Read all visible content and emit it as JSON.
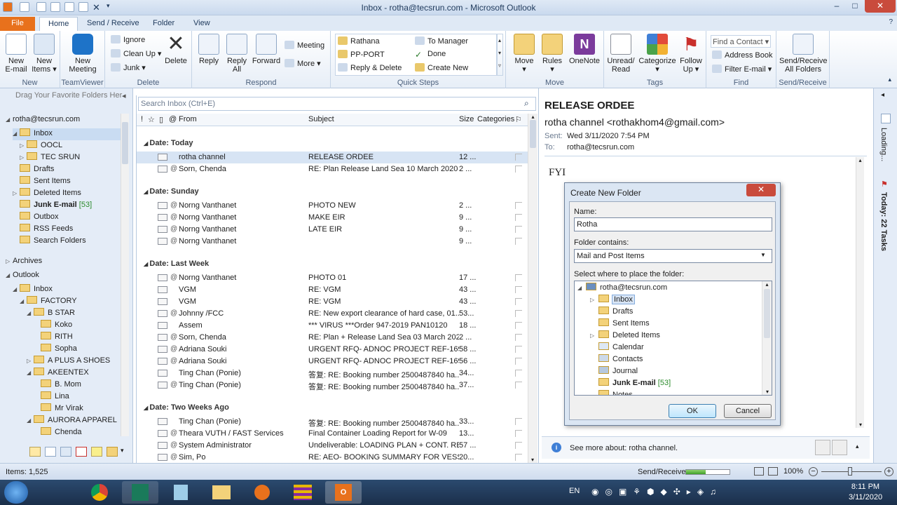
{
  "window": {
    "title": "Inbox - rotha@tecsrun.com - Microsoft Outlook",
    "minimize": "–",
    "maximize": "□",
    "close": "✕"
  },
  "tabs": [
    "File",
    "Home",
    "Send / Receive",
    "Folder",
    "View"
  ],
  "ribbon": {
    "new": {
      "new_email": "New\nE-mail",
      "new_items": "New\nItems ▾",
      "label": "New"
    },
    "teamviewer": {
      "new_meeting": "New\nMeeting",
      "label": "TeamViewer"
    },
    "delete": {
      "ignore": "Ignore",
      "clean_up": "Clean Up ▾",
      "junk": "Junk ▾",
      "delete": "Delete",
      "label": "Delete"
    },
    "respond": {
      "reply": "Reply",
      "reply_all": "Reply\nAll",
      "forward": "Forward",
      "meeting": "Meeting",
      "more": "More ▾",
      "label": "Respond"
    },
    "quick_steps": {
      "items": [
        "Rathana",
        "PP-PORT",
        "Reply & Delete",
        "To Manager",
        "Done",
        "Create New"
      ],
      "label": "Quick Steps"
    },
    "move": {
      "move": "Move\n▾",
      "rules": "Rules\n▾",
      "onenote": "OneNote",
      "label": "Move"
    },
    "tags": {
      "unread_read": "Unread/\nRead",
      "categorize": "Categorize\n▾",
      "follow_up": "Follow\nUp ▾",
      "label": "Tags"
    },
    "find": {
      "find_contact": "Find a Contact ▾",
      "address_book": "Address Book",
      "filter_email": "Filter E-mail ▾",
      "label": "Find"
    },
    "send_receive": {
      "all_folders": "Send/Receive\nAll Folders",
      "label": "Send/Receive"
    }
  },
  "nav": {
    "drag_hint": "Drag Your Favorite Folders Her",
    "account": "rotha@tecsrun.com",
    "folders": [
      {
        "name": "Inbox",
        "indent": 1,
        "arrow": "◢",
        "selected": true
      },
      {
        "name": "OOCL",
        "indent": 2,
        "arrow": "▷"
      },
      {
        "name": "TEC SRUN",
        "indent": 2,
        "arrow": "▷"
      },
      {
        "name": "Drafts",
        "indent": 1,
        "arrow": ""
      },
      {
        "name": "Sent Items",
        "indent": 1,
        "arrow": ""
      },
      {
        "name": "Deleted Items",
        "indent": 1,
        "arrow": "▷"
      },
      {
        "name": "Junk E-mail",
        "indent": 1,
        "arrow": "",
        "count": "[53]",
        "bold": true
      },
      {
        "name": "Outbox",
        "indent": 1,
        "arrow": ""
      },
      {
        "name": "RSS Feeds",
        "indent": 1,
        "arrow": ""
      },
      {
        "name": "Search Folders",
        "indent": 1,
        "arrow": ""
      }
    ],
    "archives": "Archives",
    "outlook": "Outlook",
    "outlook_folders": [
      {
        "name": "Inbox",
        "indent": 1,
        "arrow": "◢"
      },
      {
        "name": "FACTORY",
        "indent": 2,
        "arrow": "◢"
      },
      {
        "name": "B STAR",
        "indent": 3,
        "arrow": "◢"
      },
      {
        "name": "Koko",
        "indent": 4,
        "arrow": ""
      },
      {
        "name": "RITH",
        "indent": 4,
        "arrow": ""
      },
      {
        "name": "Sopha",
        "indent": 4,
        "arrow": ""
      },
      {
        "name": "A PLUS A SHOES",
        "indent": 3,
        "arrow": "▷"
      },
      {
        "name": "AKEENTEX",
        "indent": 3,
        "arrow": "◢"
      },
      {
        "name": "B. Mom",
        "indent": 4,
        "arrow": ""
      },
      {
        "name": "Lina",
        "indent": 4,
        "arrow": ""
      },
      {
        "name": "Mr Virak",
        "indent": 4,
        "arrow": ""
      },
      {
        "name": "AURORA APPAREL",
        "indent": 3,
        "arrow": "◢"
      },
      {
        "name": "Chenda",
        "indent": 4,
        "arrow": ""
      }
    ]
  },
  "list": {
    "search_placeholder": "Search Inbox (Ctrl+E)",
    "columns": {
      "from": "From",
      "subject": "Subject",
      "size": "Size",
      "categories": "Categories"
    },
    "groups": [
      {
        "title": "Date: Today",
        "rows": [
          {
            "from": "rotha channel",
            "subject": "RELEASE ORDEE",
            "size": "12 ...",
            "selected": true,
            "attach": false
          },
          {
            "from": "Sorn, Chenda",
            "subject": "RE: Plan Release Land Sea 10 March 2020",
            "size": "2 ...",
            "attach": true
          }
        ]
      },
      {
        "title": "Date: Sunday",
        "rows": [
          {
            "from": "Norng Vanthanet",
            "subject": "PHOTO NEW",
            "size": "2 ...",
            "attach": true
          },
          {
            "from": "Norng Vanthanet",
            "subject": "MAKE EIR",
            "size": "9 ...",
            "attach": true
          },
          {
            "from": "Norng Vanthanet",
            "subject": "LATE EIR",
            "size": "9 ...",
            "attach": true
          },
          {
            "from": "Norng Vanthanet",
            "subject": "",
            "size": "9 ...",
            "attach": true
          }
        ]
      },
      {
        "title": "Date: Last Week",
        "rows": [
          {
            "from": "Norng Vanthanet",
            "subject": "PHOTO 01",
            "size": "17 ...",
            "attach": true
          },
          {
            "from": "VGM",
            "subject": "RE: VGM",
            "size": "43 ...",
            "attach": false
          },
          {
            "from": "VGM",
            "subject": "RE: VGM",
            "size": "43 ...",
            "attach": false
          },
          {
            "from": "Johnny /FCC",
            "subject": "RE: New export clearance of hard case, 01...",
            "size": "53...",
            "attach": true
          },
          {
            "from": "Assem",
            "subject": "*** VIRUS ***Order 947-2019 PAN10120",
            "size": "18 ...",
            "attach": false
          },
          {
            "from": "Sorn, Chenda",
            "subject": "RE: Plan + Release Land Sea 03 March 2020",
            "size": "2 ...",
            "attach": true
          },
          {
            "from": "Adriana Souki",
            "subject": "URGENT RFQ- ADNOC PROJECT REF-16942...",
            "size": "58 ...",
            "attach": true
          },
          {
            "from": "Adriana Souki",
            "subject": "URGENT RFQ- ADNOC PROJECT REF-16942...",
            "size": "56 ...",
            "attach": true
          },
          {
            "from": "Ting Chan  (Ponie)",
            "subject": "答复: RE: Booking number 2500487840 ha...",
            "size": "34...",
            "attach": false
          },
          {
            "from": "Ting Chan  (Ponie)",
            "subject": "答复: RE: Booking number 2500487840 ha...",
            "size": "37...",
            "attach": true
          }
        ]
      },
      {
        "title": "Date: Two Weeks Ago",
        "rows": [
          {
            "from": "Ting Chan  (Ponie)",
            "subject": "答复: RE: Booking number 2500487840 ha...",
            "size": "33...",
            "attach": false
          },
          {
            "from": "Theara VUTH / FAST Services",
            "subject": "Final Container Loading Report for W-09",
            "size": "13...",
            "attach": true
          },
          {
            "from": "System Administrator",
            "subject": "Undeliverable: LOADING PLAN + CONT. RE...",
            "size": "57 ...",
            "attach": true
          },
          {
            "from": "Sim, Po",
            "subject": "RE: AEO- BOOKING SUMMARY FOR VESSE...",
            "size": "20...",
            "attach": true
          }
        ]
      }
    ]
  },
  "reading": {
    "subject": "RELEASE ORDEE",
    "from": "rotha channel <rothakhom4@gmail.com>",
    "sent_label": "Sent:",
    "sent": "Wed 3/11/2020 7:54 PM",
    "to_label": "To:",
    "to": "rotha@tecsrun.com",
    "body": "FYI",
    "people_pane": "See more about: rotha channel."
  },
  "todo": {
    "loading": "Loading...",
    "tasks": "Today: 22 Tasks"
  },
  "dialog": {
    "title": "Create New Folder",
    "name_label": "Name:",
    "name_value": "Rotha",
    "contains_label": "Folder contains:",
    "contains_value": "Mail and Post Items",
    "place_label": "Select where to place the folder:",
    "tree": [
      {
        "name": "rotha@tecsrun.com",
        "level": 0,
        "arrow": "◢",
        "icon": "account"
      },
      {
        "name": "Inbox",
        "level": 1,
        "arrow": "▷",
        "icon": "folder",
        "selected": true
      },
      {
        "name": "Drafts",
        "level": 1,
        "arrow": "",
        "icon": "folder"
      },
      {
        "name": "Sent Items",
        "level": 1,
        "arrow": "",
        "icon": "folder"
      },
      {
        "name": "Deleted Items",
        "level": 1,
        "arrow": "▷",
        "icon": "folder"
      },
      {
        "name": "Calendar",
        "level": 1,
        "arrow": "",
        "icon": "calendar"
      },
      {
        "name": "Contacts",
        "level": 1,
        "arrow": "",
        "icon": "contacts"
      },
      {
        "name": "Journal",
        "level": 1,
        "arrow": "",
        "icon": "journal"
      },
      {
        "name": "Junk E-mail",
        "level": 1,
        "arrow": "",
        "icon": "folder",
        "count": "[53]",
        "bold": true
      },
      {
        "name": "Notes",
        "level": 1,
        "arrow": "",
        "icon": "folder"
      }
    ],
    "ok": "OK",
    "cancel": "Cancel"
  },
  "status": {
    "items": "Items: 1,525",
    "send_receive": "Send/Receive",
    "zoom": "100%",
    "send_receive_progress": 0.45
  },
  "taskbar": {
    "lang": "EN",
    "time": "8:11 PM",
    "date": "3/11/2020"
  },
  "colors": {
    "accent": "#e8711c",
    "selection": "#d7e4f4",
    "ribbon_blue": "#1e395b",
    "flag": "#c9302c"
  }
}
